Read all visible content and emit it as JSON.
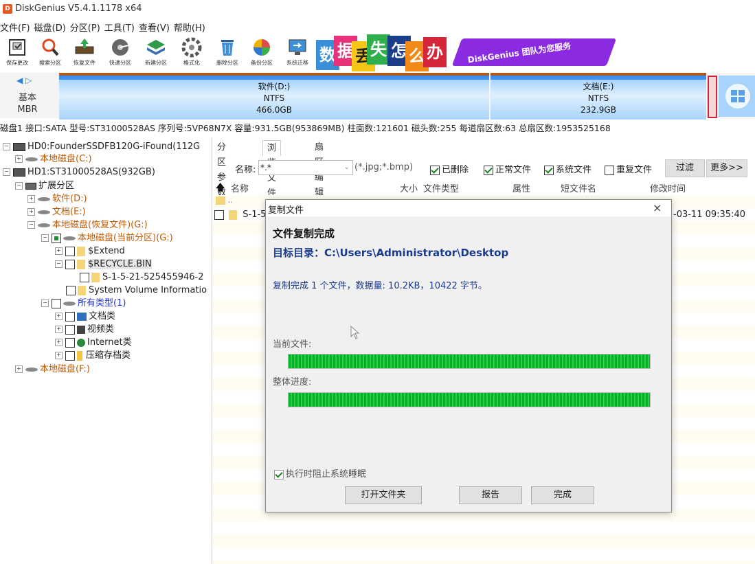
{
  "window": {
    "title": "DiskGenius V5.4.1.1178 x64",
    "app_icon_text": "D"
  },
  "menu": [
    "文件(F)",
    "磁盘(D)",
    "分区(P)",
    "工具(T)",
    "查看(V)",
    "帮助(H)"
  ],
  "toolbar": [
    {
      "label": "保存更改",
      "icon": "save-icon"
    },
    {
      "label": "搜索分区",
      "icon": "magnifier-icon"
    },
    {
      "label": "恢复文件",
      "icon": "recover-icon"
    },
    {
      "label": "快速分区",
      "icon": "quick-partition-icon"
    },
    {
      "label": "新建分区",
      "icon": "new-partition-icon"
    },
    {
      "label": "格式化",
      "icon": "format-icon"
    },
    {
      "label": "删除分区",
      "icon": "trash-icon"
    },
    {
      "label": "备份分区",
      "icon": "backup-icon"
    },
    {
      "label": "系统迁移",
      "icon": "migrate-icon"
    }
  ],
  "banner": {
    "chars": [
      "数",
      "据",
      "丢",
      "失",
      "怎",
      "么",
      "办"
    ],
    "slogan": "DiskGenius 团队为您服务"
  },
  "diskbar": {
    "label": [
      "基本",
      "MBR"
    ],
    "partitions": [
      {
        "name": "软件(D:)",
        "fs": "NTFS",
        "size": "466.0GB"
      },
      {
        "name": "文档(E:)",
        "fs": "NTFS",
        "size": "232.9GB"
      }
    ]
  },
  "disk_info": "磁盘1 接口:SATA  型号:ST31000528AS  序列号:5VP68N7X  容量:931.5GB(953869MB)  柱面数:121601  磁头数:255  每道扇区数:63  总扇区数:1953525168",
  "tree": {
    "hd0": "HD0:FounderSSDFB120G-iFound(112G",
    "c_drive": "本地磁盘(C:)",
    "hd1": "HD1:ST31000528AS(932GB)",
    "extended": "扩展分区",
    "d_drive": "软件(D:)",
    "e_drive": "文档(E:)",
    "g_drive": "本地磁盘(恢复文件)(G:)",
    "g_current": "本地磁盘(当前分区)(G:)",
    "extend": "$Extend",
    "recycle": "$RECYCLE.BIN",
    "sid": "S-1-5-21-525455946-2",
    "svi": "System Volume Informatio",
    "all_types": "所有类型(1)",
    "doc_type": "文档类",
    "video_type": "视频类",
    "internet_type": "Internet类",
    "zip_type": "压缩存档类",
    "f_drive": "本地磁盘(F:)"
  },
  "tabs": [
    "分区参数",
    "浏览文件",
    "扇区编辑"
  ],
  "filter": {
    "name_label": "名称:",
    "name_value": "*.*",
    "hint": "(*.jpg;*.bmp)",
    "deleted": "已删除",
    "normal": "正常文件",
    "system": "系统文件",
    "duplicate": "重复文件",
    "filter_btn": "过滤",
    "more_btn": "更多>>"
  },
  "columns": [
    "名称",
    "大小",
    "文件类型",
    "属性",
    "短文件名",
    "修改时间"
  ],
  "rows": [
    {
      "name": "S-1-5",
      "modified": "-03-11 09:35:40"
    }
  ],
  "parent_dir": "..",
  "dialog": {
    "title": "复制文件",
    "close": "×",
    "heading": "文件复制完成",
    "target": "目标目录：C:\\Users\\Administrator\\Desktop",
    "summary": "复制完成 1 个文件，数据量: 10.2KB，10422 字节。",
    "current_label": "当前文件:",
    "current_progress": 1.0,
    "overall_label": "整体进度:",
    "overall_progress": 1.0,
    "prevent_sleep": "执行时阻止系统睡眠",
    "btn_open": "打开文件夹",
    "btn_report": "报告",
    "btn_done": "完成"
  }
}
